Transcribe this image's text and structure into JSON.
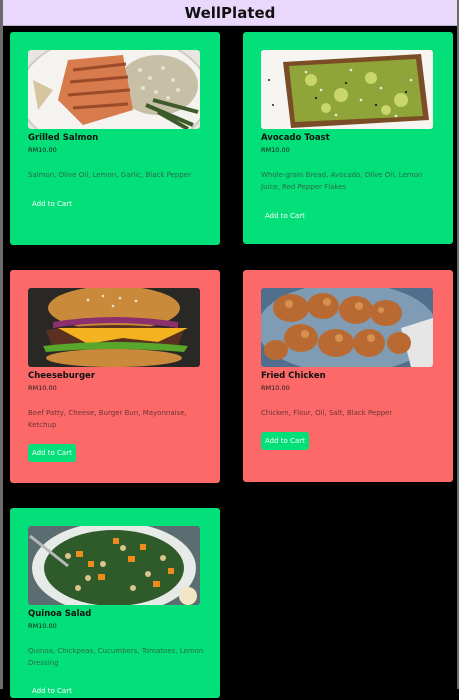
{
  "app": {
    "title": "WellPlated"
  },
  "menu": {
    "items": [
      {
        "name": "Grilled Salmon",
        "price": "RM10.00",
        "ingredients": "Salmon, Olive Oil, Lemon, Garlic, Black Pepper",
        "button": "Add to Cart",
        "card_color": "#04e079"
      },
      {
        "name": "Avocado Toast",
        "price": "RM10.00",
        "ingredients": "Whole-grain Bread, Avocado, Olive Oil, Lemon Juice, Red Pepper Flakes",
        "button": "Add to Cart",
        "card_color": "#04e079"
      },
      {
        "name": "Cheeseburger",
        "price": "RM10.00",
        "ingredients": "Beef Patty, Cheese, Burger Bun, Mayonnaise, Ketchup",
        "button": "Add to Cart",
        "card_color": "#fd6868"
      },
      {
        "name": "Fried Chicken",
        "price": "RM10.00",
        "ingredients": "Chicken, Flour, Oil, Salt, Black Pepper",
        "button": "Add to Cart",
        "card_color": "#fd6868"
      },
      {
        "name": "Quinoa Salad",
        "price": "RM10.00",
        "ingredients": "Quinoa, Chickpeas, Cucumbers, Tomatoes, Lemon Dressing",
        "button": "Add to Cart",
        "card_color": "#04e079"
      }
    ]
  }
}
